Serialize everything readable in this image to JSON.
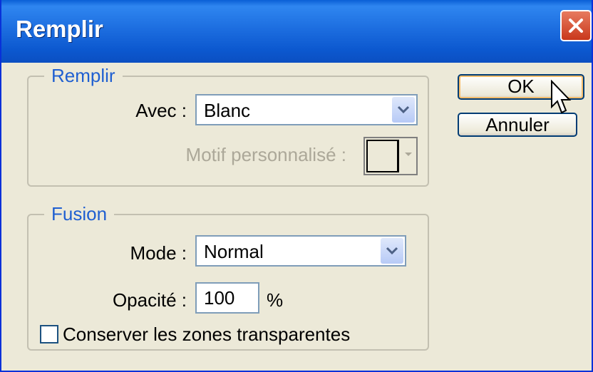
{
  "dialog": {
    "title": "Remplir"
  },
  "fill_group": {
    "legend": "Remplir",
    "with_label": "Avec :",
    "with_value": "Blanc",
    "pattern_label": "Motif personnalisé :"
  },
  "blend_group": {
    "legend": "Fusion",
    "mode_label": "Mode :",
    "mode_value": "Normal",
    "opacity_label": "Opacité :",
    "opacity_value": "100",
    "opacity_unit": "%",
    "preserve_label": "Conserver les zones transparentes",
    "preserve_checked": false
  },
  "buttons": {
    "ok": "OK",
    "cancel": "Annuler"
  },
  "colors": {
    "title_bar": "#0a5fd6",
    "dialog_bg": "#ece9d8",
    "legend_text": "#1f5fd1"
  }
}
